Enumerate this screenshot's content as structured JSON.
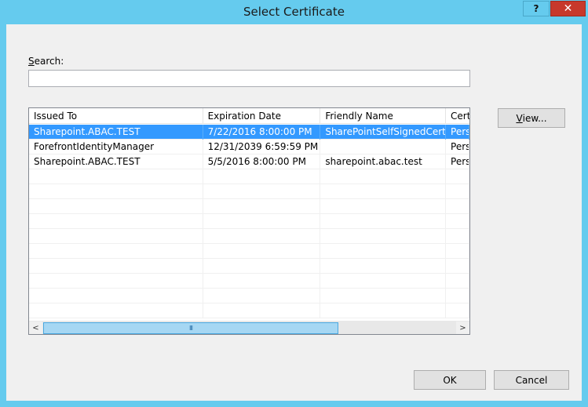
{
  "window": {
    "title": "Select Certificate",
    "help_label": "?",
    "close_label": "✕",
    "accent_color": "#65cbee",
    "close_color": "#c7382b"
  },
  "search": {
    "label_prefix": "S",
    "label_rest": "earch:",
    "value": "",
    "placeholder": ""
  },
  "list": {
    "columns": [
      "Issued To",
      "Expiration Date",
      "Friendly Name",
      "Cert"
    ],
    "rows": [
      {
        "issued_to": "Sharepoint.ABAC.TEST",
        "expiration": "7/22/2016 8:00:00 PM",
        "friendly_name": "SharePointSelfSignedCert",
        "cert": "Pers",
        "selected": true
      },
      {
        "issued_to": "ForefrontIdentityManager",
        "expiration": "12/31/2039 6:59:59 PM",
        "friendly_name": "",
        "cert": "Pers",
        "selected": false
      },
      {
        "issued_to": "Sharepoint.ABAC.TEST",
        "expiration": "5/5/2016 8:00:00 PM",
        "friendly_name": "sharepoint.abac.test",
        "cert": "Pers",
        "selected": false
      }
    ],
    "selection_color": "#3399ff",
    "scroll_left_icon": "<",
    "scroll_right_icon": ">",
    "scroll_thumb_grip": "III"
  },
  "buttons": {
    "view_prefix": "V",
    "view_rest": "iew...",
    "ok": "OK",
    "cancel": "Cancel"
  }
}
